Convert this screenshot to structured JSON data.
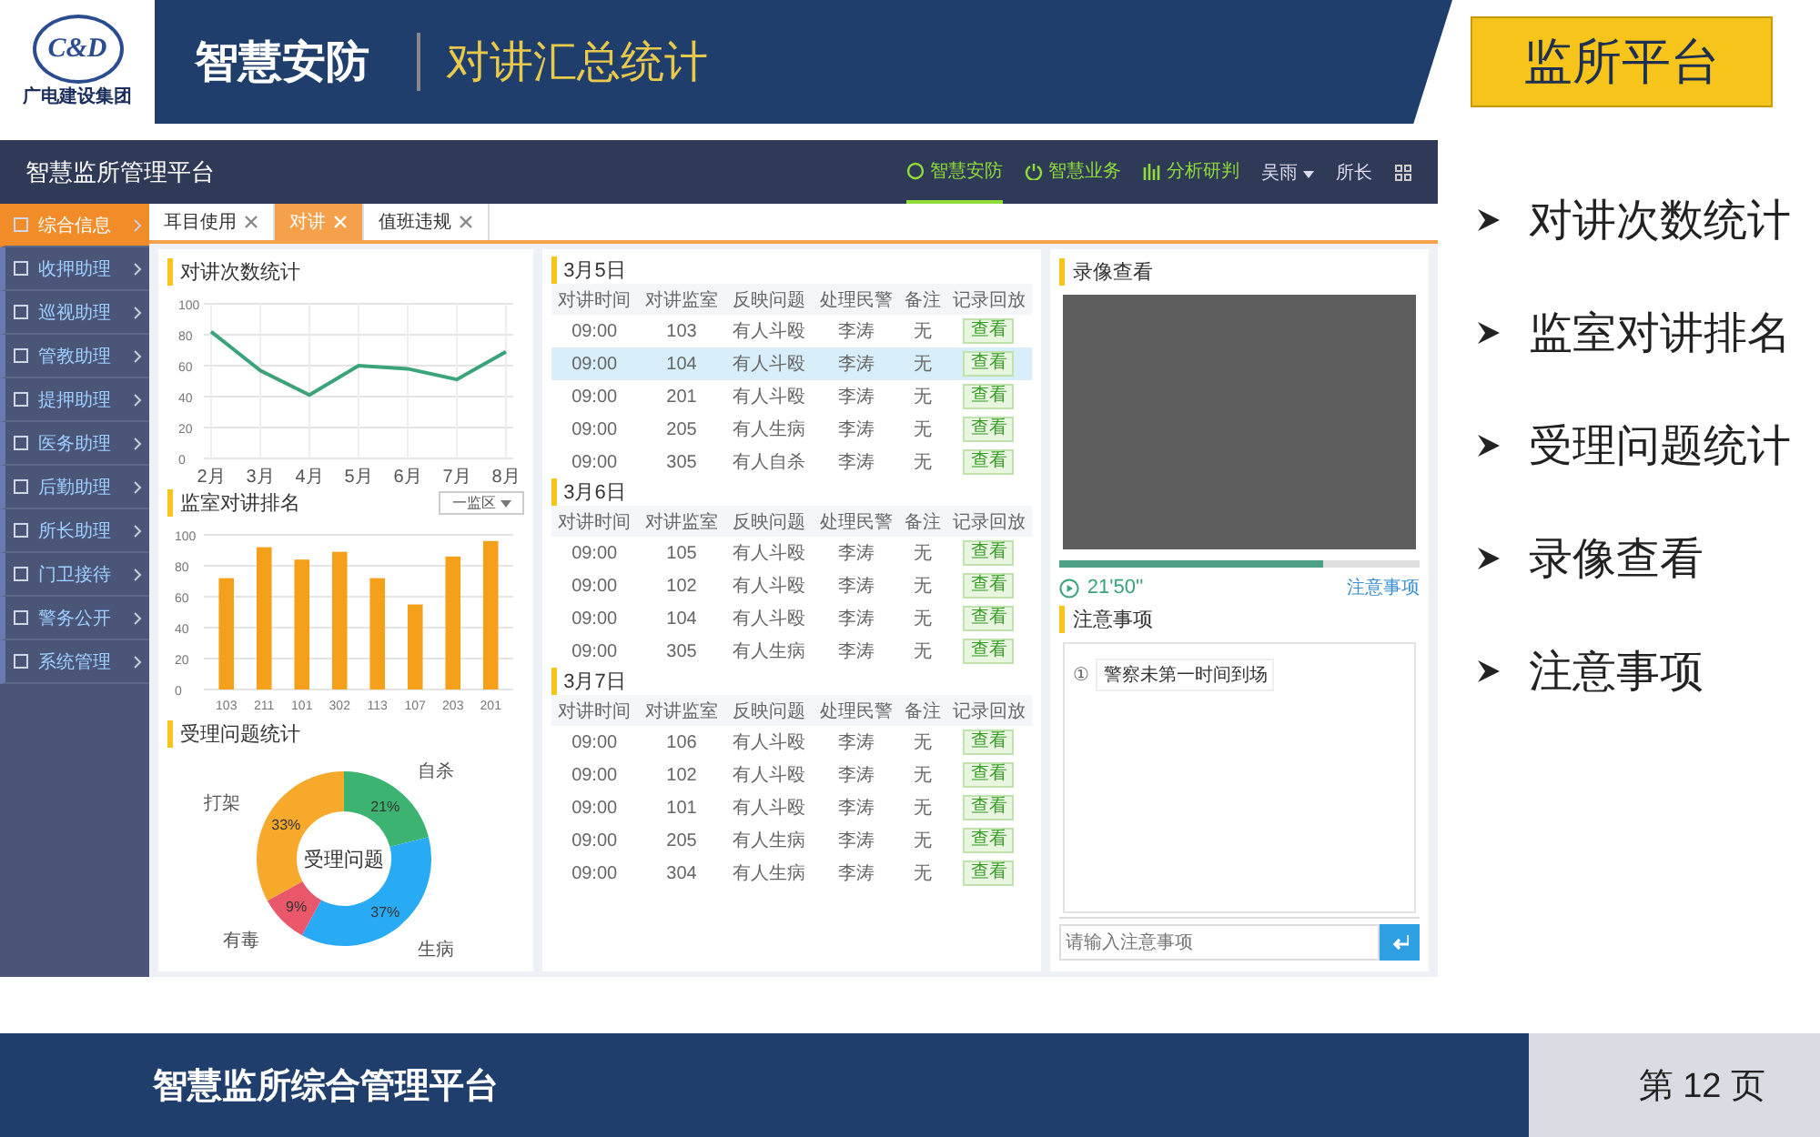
{
  "slide": {
    "logo_text": "C&D",
    "company": "广电建设集团",
    "title": "智慧安防",
    "subtitle": "对讲汇总统计",
    "badge": "监所平台",
    "bullets": [
      "对讲次数统计",
      "监室对讲排名",
      "受理问题统计",
      "录像查看",
      "注意事项"
    ],
    "footer": "智慧监所综合管理平台",
    "page": "第 12 页"
  },
  "app": {
    "title": "智慧监所管理平台",
    "nav": [
      {
        "label": "智慧安防",
        "kind": "circle",
        "selected": true
      },
      {
        "label": "智慧业务",
        "kind": "power",
        "selected": false
      },
      {
        "label": "分析研判",
        "kind": "bars",
        "selected": false
      }
    ],
    "user": "吴雨",
    "role": "所长",
    "sidebar": [
      {
        "label": "综合信息",
        "selected": true
      },
      {
        "label": "收押助理",
        "selected": false
      },
      {
        "label": "巡视助理",
        "selected": false
      },
      {
        "label": "管教助理",
        "selected": false
      },
      {
        "label": "提押助理",
        "selected": false
      },
      {
        "label": "医务助理",
        "selected": false
      },
      {
        "label": "后勤助理",
        "selected": false
      },
      {
        "label": "所长助理",
        "selected": false
      },
      {
        "label": "门卫接待",
        "selected": false
      },
      {
        "label": "警务公开",
        "selected": false
      },
      {
        "label": "系统管理",
        "selected": false
      }
    ],
    "tabs": [
      {
        "label": "耳目使用",
        "selected": false
      },
      {
        "label": "对讲",
        "selected": true
      },
      {
        "label": "值班违规",
        "selected": false
      }
    ],
    "line_panel": {
      "title": "对讲次数统计",
      "chart_data": {
        "type": "line",
        "categories": [
          "2月",
          "3月",
          "4月",
          "5月",
          "6月",
          "7月",
          "8月"
        ],
        "ylim": [
          0,
          100
        ],
        "yticks": [
          0,
          20,
          40,
          60,
          80,
          100
        ],
        "grid": true,
        "series": [
          {
            "color": "#3aa37a",
            "values": [
              82,
              57,
              41,
              60,
              58,
              51,
              69
            ]
          }
        ]
      }
    },
    "bar_panel": {
      "title": "监室对讲排名",
      "filter": "一监区",
      "chart_data": {
        "type": "bar",
        "categories": [
          "103",
          "211",
          "101",
          "302",
          "113",
          "107",
          "203",
          "201"
        ],
        "ylim": [
          0,
          100
        ],
        "yticks": [
          0,
          20,
          40,
          60,
          80,
          100
        ],
        "grid": true,
        "series": [
          {
            "color": "#f5a01a",
            "values": [
              72,
              92,
              84,
              89,
              72,
              55,
              86,
              96
            ]
          }
        ]
      }
    },
    "donut_panel": {
      "title": "受理问题统计",
      "center_label": "受理问题",
      "chart_data": {
        "type": "donut",
        "categories": [
          "自杀",
          "生病",
          "有毒",
          "打架"
        ],
        "series": [
          {
            "values": [
              21,
              37,
              9,
              33
            ]
          }
        ],
        "value_labels": [
          "21%",
          "37%",
          "9%",
          "33%"
        ],
        "colors": [
          "#3cb371",
          "#29aaf4",
          "#e8586a",
          "#f6a92b"
        ]
      }
    },
    "days": [
      {
        "date": "3月5日",
        "columns": [
          "对讲时间",
          "对讲监室",
          "反映问题",
          "处理民警",
          "备注",
          "记录回放"
        ],
        "rows": [
          {
            "time": "09:00",
            "room": "103",
            "issue": "有人斗殴",
            "officer": "李涛",
            "note": "无",
            "action": "查看",
            "selected": false
          },
          {
            "time": "09:00",
            "room": "104",
            "issue": "有人斗殴",
            "officer": "李涛",
            "note": "无",
            "action": "查看",
            "selected": true
          },
          {
            "time": "09:00",
            "room": "201",
            "issue": "有人斗殴",
            "officer": "李涛",
            "note": "无",
            "action": "查看",
            "selected": false
          },
          {
            "time": "09:00",
            "room": "205",
            "issue": "有人生病",
            "officer": "李涛",
            "note": "无",
            "action": "查看",
            "selected": false
          },
          {
            "time": "09:00",
            "room": "305",
            "issue": "有人自杀",
            "officer": "李涛",
            "note": "无",
            "action": "查看",
            "selected": false
          }
        ]
      },
      {
        "date": "3月6日",
        "columns": [
          "对讲时间",
          "对讲监室",
          "反映问题",
          "处理民警",
          "备注",
          "记录回放"
        ],
        "rows": [
          {
            "time": "09:00",
            "room": "105",
            "issue": "有人斗殴",
            "officer": "李涛",
            "note": "无",
            "action": "查看",
            "selected": false
          },
          {
            "time": "09:00",
            "room": "102",
            "issue": "有人斗殴",
            "officer": "李涛",
            "note": "无",
            "action": "查看",
            "selected": false
          },
          {
            "time": "09:00",
            "room": "104",
            "issue": "有人斗殴",
            "officer": "李涛",
            "note": "无",
            "action": "查看",
            "selected": false
          },
          {
            "time": "09:00",
            "room": "305",
            "issue": "有人生病",
            "officer": "李涛",
            "note": "无",
            "action": "查看",
            "selected": false
          }
        ]
      },
      {
        "date": "3月7日",
        "columns": [
          "对讲时间",
          "对讲监室",
          "反映问题",
          "处理民警",
          "备注",
          "记录回放"
        ],
        "rows": [
          {
            "time": "09:00",
            "room": "106",
            "issue": "有人斗殴",
            "officer": "李涛",
            "note": "无",
            "action": "查看",
            "selected": false
          },
          {
            "time": "09:00",
            "room": "102",
            "issue": "有人斗殴",
            "officer": "李涛",
            "note": "无",
            "action": "查看",
            "selected": false
          },
          {
            "time": "09:00",
            "room": "101",
            "issue": "有人斗殴",
            "officer": "李涛",
            "note": "无",
            "action": "查看",
            "selected": false
          },
          {
            "time": "09:00",
            "room": "205",
            "issue": "有人生病",
            "officer": "李涛",
            "note": "无",
            "action": "查看",
            "selected": false
          },
          {
            "time": "09:00",
            "room": "304",
            "issue": "有人生病",
            "officer": "李涛",
            "note": "无",
            "action": "查看",
            "selected": false
          }
        ]
      }
    ],
    "video": {
      "title": "录像查看",
      "level": 0.73,
      "time": "21'50''",
      "link": "注意事项"
    },
    "notes": {
      "title": "注意事项",
      "items": [
        {
          "mark": "①",
          "text": "警察未第一时间到场"
        }
      ],
      "placeholder": "请输入注意事项"
    }
  }
}
